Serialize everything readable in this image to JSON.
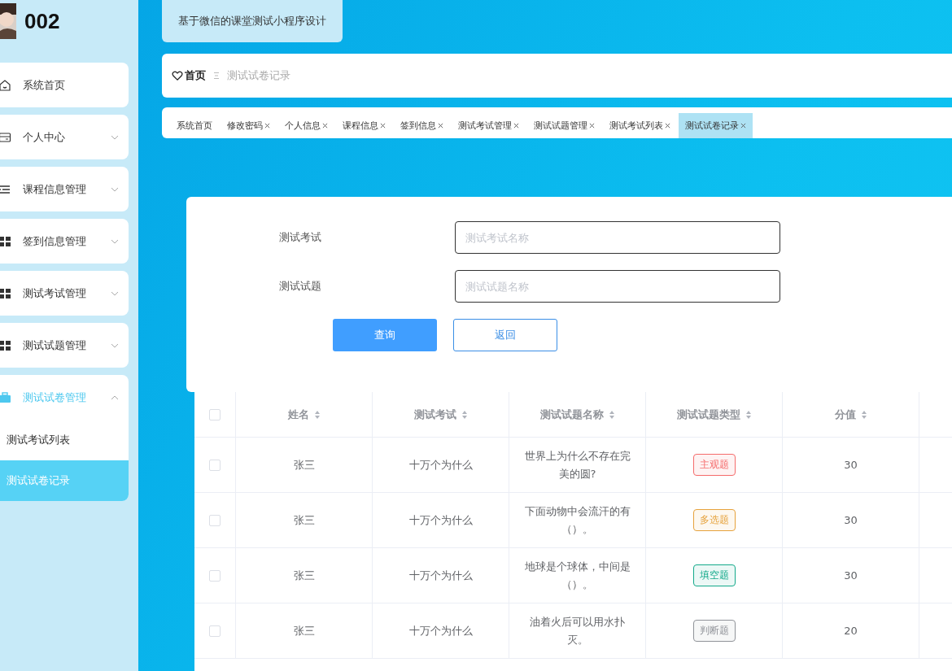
{
  "sidebar": {
    "username": "002",
    "menu": [
      {
        "label": "系统首页",
        "has_children": false,
        "active": false
      },
      {
        "label": "个人中心",
        "has_children": true,
        "expanded": false,
        "active": false
      },
      {
        "label": "课程信息管理",
        "has_children": true,
        "expanded": false,
        "active": false
      },
      {
        "label": "签到信息管理",
        "has_children": true,
        "expanded": false,
        "active": false
      },
      {
        "label": "测试考试管理",
        "has_children": true,
        "expanded": false,
        "active": false
      },
      {
        "label": "测试试题管理",
        "has_children": true,
        "expanded": false,
        "active": false
      },
      {
        "label": "测试试卷管理",
        "has_children": true,
        "expanded": true,
        "active": true,
        "children": [
          {
            "label": "测试考试列表",
            "selected": false
          },
          {
            "label": "测试试卷记录",
            "selected": true
          }
        ]
      }
    ]
  },
  "header": {
    "title": "基于微信的课堂测试小程序设计"
  },
  "breadcrumb": {
    "home": "首页",
    "current": "测试试卷记录"
  },
  "tabs": [
    {
      "label": "系统首页",
      "closable": false,
      "selected": false
    },
    {
      "label": "修改密码",
      "closable": true,
      "selected": false
    },
    {
      "label": "个人信息",
      "closable": true,
      "selected": false
    },
    {
      "label": "课程信息",
      "closable": true,
      "selected": false
    },
    {
      "label": "签到信息",
      "closable": true,
      "selected": false
    },
    {
      "label": "测试考试管理",
      "closable": true,
      "selected": false
    },
    {
      "label": "测试试题管理",
      "closable": true,
      "selected": false
    },
    {
      "label": "测试考试列表",
      "closable": true,
      "selected": false
    },
    {
      "label": "测试试卷记录",
      "closable": true,
      "selected": true
    }
  ],
  "search": {
    "fields": [
      {
        "label": "测试考试",
        "placeholder": "测试考试名称"
      },
      {
        "label": "测试试题",
        "placeholder": "测试试题名称"
      }
    ],
    "buttons": [
      {
        "label": "查询",
        "kind": "primary"
      },
      {
        "label": "返回",
        "kind": "plain"
      }
    ]
  },
  "table": {
    "all_checked": false,
    "columns": [
      "姓名",
      "测试考试",
      "测试试题名称",
      "测试试题类型",
      "分值"
    ],
    "rows": [
      {
        "checked": false,
        "name": "张三",
        "exam": "十万个为什么",
        "question": "世界上为什么不存在完美的圆?",
        "type": "主观题",
        "color": "#f56c6c",
        "score": "30"
      },
      {
        "checked": false,
        "name": "张三",
        "exam": "十万个为什么",
        "question": "下面动物中会流汗的有（）。",
        "type": "多选题",
        "color": "#e6a23c",
        "score": "30"
      },
      {
        "checked": false,
        "name": "张三",
        "exam": "十万个为什么",
        "question": "地球是个球体，中间是（）。",
        "type": "填空题",
        "color": "#13a98a",
        "score": "30"
      },
      {
        "checked": false,
        "name": "张三",
        "exam": "十万个为什么",
        "question": "油着火后可以用水扑灭。",
        "type": "判断题",
        "color": "#909399",
        "score": "20"
      }
    ]
  }
}
